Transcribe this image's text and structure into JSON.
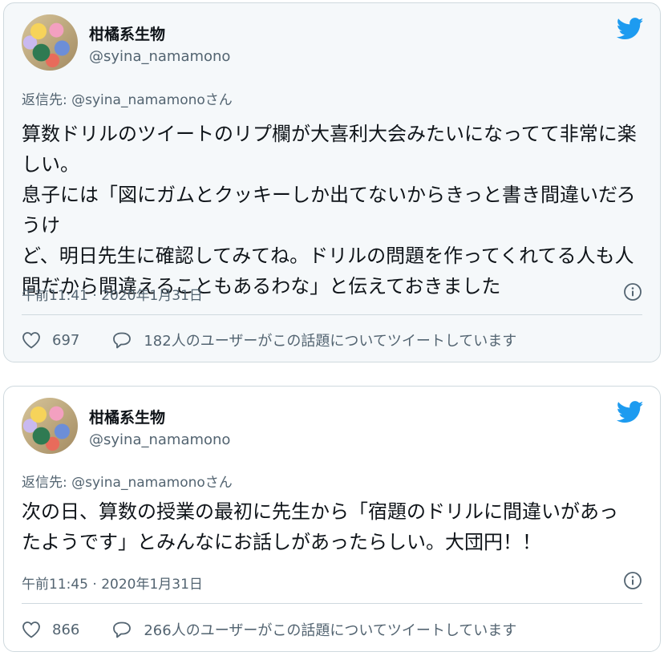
{
  "tweets": [
    {
      "user": {
        "name": "柑橘系生物",
        "handle": "@syina_namamono"
      },
      "reply_prefix": "返信先:",
      "reply_mention": "@syina_namamonoさん",
      "text": "算数ドリルのツイートのリプ欄が大喜利大会みたいになってて非常に楽\nしい。\n息子には「図にガムとクッキーしか出てないからきっと書き間違いだろうけ\nど、明日先生に確認してみてね。ドリルの問題を作ってくれてる人も人\n間だから間違えることもあるわな」と伝えておきました",
      "timestamp": "午前11:41 · 2020年1月31日",
      "likes": "697",
      "replies_text": "182人のユーザーがこの話題についてツイートしています"
    },
    {
      "user": {
        "name": "柑橘系生物",
        "handle": "@syina_namamono"
      },
      "reply_prefix": "返信先:",
      "reply_mention": "@syina_namamonoさん",
      "text": "次の日、算数の授業の最初に先生から「宿題のドリルに間違いがあっ\nたようです」とみんなにお話しがあったらしい。大団円！！",
      "timestamp": "午前11:45 · 2020年1月31日",
      "likes": "866",
      "replies_text": "266人のユーザーがこの話題についてツイートしています"
    }
  ],
  "colors": {
    "brand": "#1d9bf0",
    "text_primary": "#0f1419",
    "text_secondary": "#536471",
    "border": "#cfd9de",
    "card1_bg": "#f5f8fa"
  },
  "icons": [
    "twitter-bird-icon",
    "info-icon",
    "heart-icon",
    "reply-bubble-icon"
  ]
}
